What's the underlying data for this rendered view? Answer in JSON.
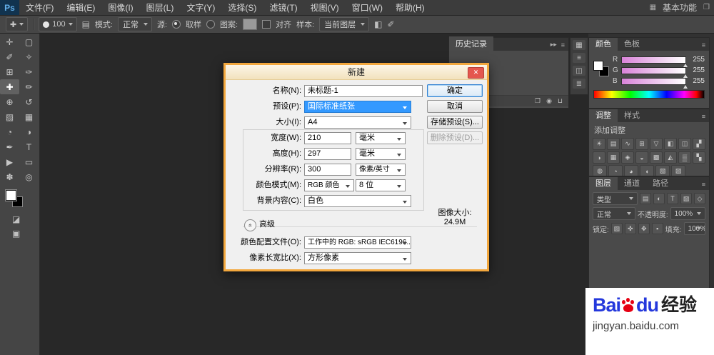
{
  "menubar": {
    "logo": "Ps",
    "items": [
      "文件(F)",
      "编辑(E)",
      "图像(I)",
      "图层(L)",
      "文字(Y)",
      "选择(S)",
      "滤镜(T)",
      "视图(V)",
      "窗口(W)",
      "帮助(H)"
    ],
    "workspace": "基本功能"
  },
  "icons": {
    "workspace_grid": "▦",
    "window_restore": "❐",
    "panel_menu": "≡",
    "history_collapse": "▸▸",
    "advanced_chevrons": "«",
    "panel_toggle": "▤"
  },
  "optionsbar": {
    "tool_icon": "✚",
    "brush_size": "100",
    "mode_label": "模式:",
    "mode_value": "正常",
    "source_label": "源:",
    "sampled_label": "取样",
    "pattern_label": "图案:",
    "aligned_label": "对齐",
    "sample_label": "样本:",
    "sample_value": "当前图层",
    "extra_icons": [
      "◧",
      "✐"
    ]
  },
  "toolbar": {
    "tools": [
      {
        "name": "move",
        "glyph": "✛"
      },
      {
        "name": "marquee",
        "glyph": "▢"
      },
      {
        "name": "lasso",
        "glyph": "✐"
      },
      {
        "name": "quick-selection",
        "glyph": "✧"
      },
      {
        "name": "crop",
        "glyph": "⊞"
      },
      {
        "name": "eyedropper",
        "glyph": "✑"
      },
      {
        "name": "healing-brush",
        "glyph": "✚"
      },
      {
        "name": "brush",
        "glyph": "✏"
      },
      {
        "name": "clone-stamp",
        "glyph": "⊕"
      },
      {
        "name": "history-brush",
        "glyph": "↺"
      },
      {
        "name": "eraser",
        "glyph": "▨"
      },
      {
        "name": "gradient",
        "glyph": "▦"
      },
      {
        "name": "blur",
        "glyph": "◔"
      },
      {
        "name": "dodge",
        "glyph": "◑"
      },
      {
        "name": "pen",
        "glyph": "✒"
      },
      {
        "name": "type",
        "glyph": "T"
      },
      {
        "name": "path-selection",
        "glyph": "▶"
      },
      {
        "name": "shape",
        "glyph": "▭"
      },
      {
        "name": "hand",
        "glyph": "✽"
      },
      {
        "name": "zoom",
        "glyph": "◎"
      }
    ],
    "quickmask_icon": "◪",
    "screenmode_icon": "▣"
  },
  "history": {
    "title": "历史记录",
    "footer_icons": [
      "❐",
      "◉",
      "⊔"
    ]
  },
  "dock_icons": [
    "▦",
    "≡",
    "◫",
    "≣"
  ],
  "color_panel": {
    "tabs": [
      "颜色",
      "色板"
    ],
    "channels": [
      {
        "label": "R",
        "value": "255"
      },
      {
        "label": "G",
        "value": "255"
      },
      {
        "label": "B",
        "value": "255"
      }
    ]
  },
  "adjustments_panel": {
    "tabs": [
      "调整",
      "样式"
    ],
    "add_label": "添加调整",
    "icons": [
      [
        "☀",
        "▤",
        "∿",
        "⊞",
        "▽",
        "◧",
        "◫",
        "▞"
      ],
      [
        "◑",
        "▦",
        "◈",
        "◒",
        "▩",
        "◭",
        "▒",
        "▚"
      ],
      [
        "◍",
        "◔",
        "◕",
        "◖",
        "▧",
        "▨"
      ]
    ]
  },
  "layers_panel": {
    "tabs": [
      "图层",
      "通道",
      "路径"
    ],
    "filter_label": "类型",
    "filter_icons": [
      "▤",
      "◐",
      "T",
      "▨",
      "◇"
    ],
    "blend_mode": "正常",
    "opacity_label": "不透明度:",
    "opacity_value": "100%",
    "lock_label": "锁定:",
    "lock_icons": [
      "▨",
      "✜",
      "✥",
      "▪"
    ],
    "fill_label": "填充:",
    "fill_value": "100%"
  },
  "dialog": {
    "title": "新建",
    "close_icon": "✕",
    "rows": {
      "name": {
        "label": "名称(N):",
        "value": "未标题-1"
      },
      "preset": {
        "label": "预设(P):",
        "value": "国际标准纸张"
      },
      "size": {
        "label": "大小(I):",
        "value": "A4"
      },
      "width": {
        "label": "宽度(W):",
        "value": "210",
        "unit": "毫米"
      },
      "height": {
        "label": "高度(H):",
        "value": "297",
        "unit": "毫米"
      },
      "resolution": {
        "label": "分辨率(R):",
        "value": "300",
        "unit": "像素/英寸"
      },
      "color_mode": {
        "label": "颜色模式(M):",
        "value": "RGB 颜色",
        "depth": "8 位"
      },
      "background": {
        "label": "背景内容(C):",
        "value": "白色"
      },
      "advanced": {
        "label": "高级"
      },
      "profile": {
        "label": "颜色配置文件(O):",
        "value": "工作中的 RGB: sRGB IEC6196..."
      },
      "aspect": {
        "label": "像素长宽比(X):",
        "value": "方形像素"
      }
    },
    "buttons": {
      "ok": "确定",
      "cancel": "取消",
      "save": "存储预设(S)...",
      "delete": "删除预设(D)..."
    },
    "image_size": {
      "label": "图像大小:",
      "value": "24.9M"
    }
  },
  "watermark": {
    "bai": "Bai",
    "du": "du",
    "suffix": "经验",
    "url": "jingyan.baidu.com"
  },
  "colors": {
    "dialog_highlight_border": "#f2a73d",
    "selection_blue": "#3399ff",
    "baidu_blue": "#2438dc",
    "baidu_red": "#e60012"
  }
}
